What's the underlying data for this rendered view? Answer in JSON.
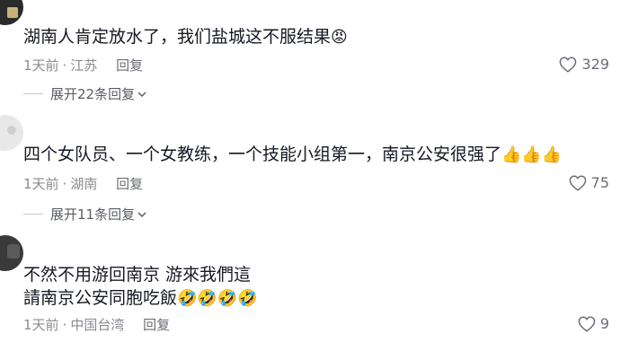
{
  "comments": [
    {
      "text": "湖南人肯定放水了，我们盐城这不服结果",
      "emoji": "😡",
      "time": "1天前",
      "location": "江苏",
      "reply_label": "回复",
      "likes": "329",
      "expand_label": "展开22条回复"
    },
    {
      "text": "四个女队员、一个女教练，一个技能小组第一，南京公安很强了",
      "emoji": "👍👍👍",
      "time": "1天前",
      "location": "湖南",
      "reply_label": "回复",
      "likes": "75",
      "expand_label": "展开11条回复"
    },
    {
      "line1": "不然不用游回南京 游來我們這",
      "line2": "請南京公安同胞吃飯",
      "emoji": "🤣🤣🤣🤣",
      "time": "1天前",
      "location": "中国台湾",
      "reply_label": "回复",
      "likes": "9"
    }
  ],
  "meta_separator": "·",
  "icons": {
    "like": "heart-outline-icon",
    "expand": "chevron-down-icon"
  }
}
